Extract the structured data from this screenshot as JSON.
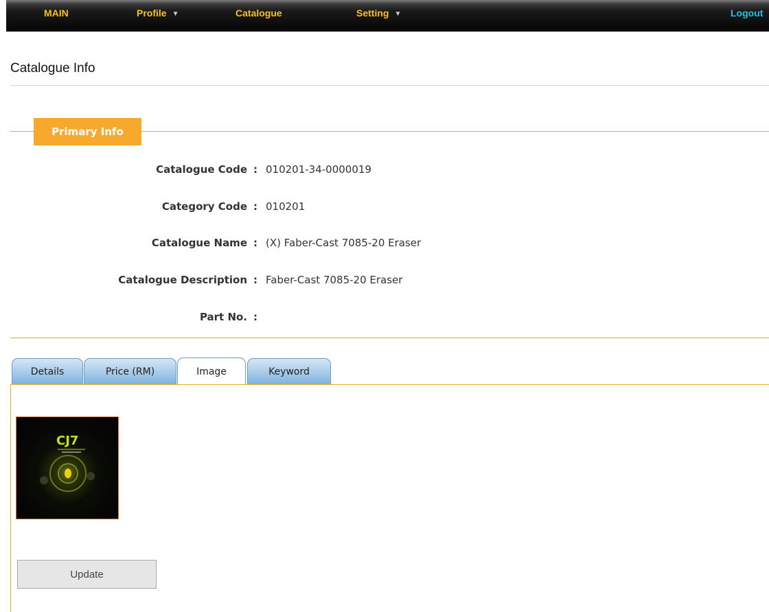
{
  "nav": {
    "main": "MAIN",
    "profile": "Profile",
    "catalogue": "Catalogue",
    "setting": "Setting",
    "logout": "Logout"
  },
  "page": {
    "title": "Catalogue Info"
  },
  "primary_info": {
    "legend": "Primary Info",
    "separator": ":",
    "rows": [
      {
        "label": "Catalogue Code",
        "value": "010201-34-0000019"
      },
      {
        "label": "Category Code",
        "value": "010201"
      },
      {
        "label": "Catalogue Name",
        "value": "(X) Faber-Cast 7085-20 Eraser"
      },
      {
        "label": "Catalogue Description",
        "value": "Faber-Cast 7085-20 Eraser"
      },
      {
        "label": "Part No.",
        "value": ""
      }
    ]
  },
  "tabs": [
    {
      "label": "Details",
      "active": false
    },
    {
      "label": "Price (RM)",
      "active": false
    },
    {
      "label": "Image",
      "active": true
    },
    {
      "label": "Keyword",
      "active": false
    }
  ],
  "image_panel": {
    "thumbnail_text": "CJ7"
  },
  "actions": {
    "update_label": "Update"
  },
  "colors": {
    "nav_text": "#ffc30f",
    "logout_text": "#19c4e8",
    "accent": "#f7a92e",
    "tab_blue": "#7fb3de"
  }
}
